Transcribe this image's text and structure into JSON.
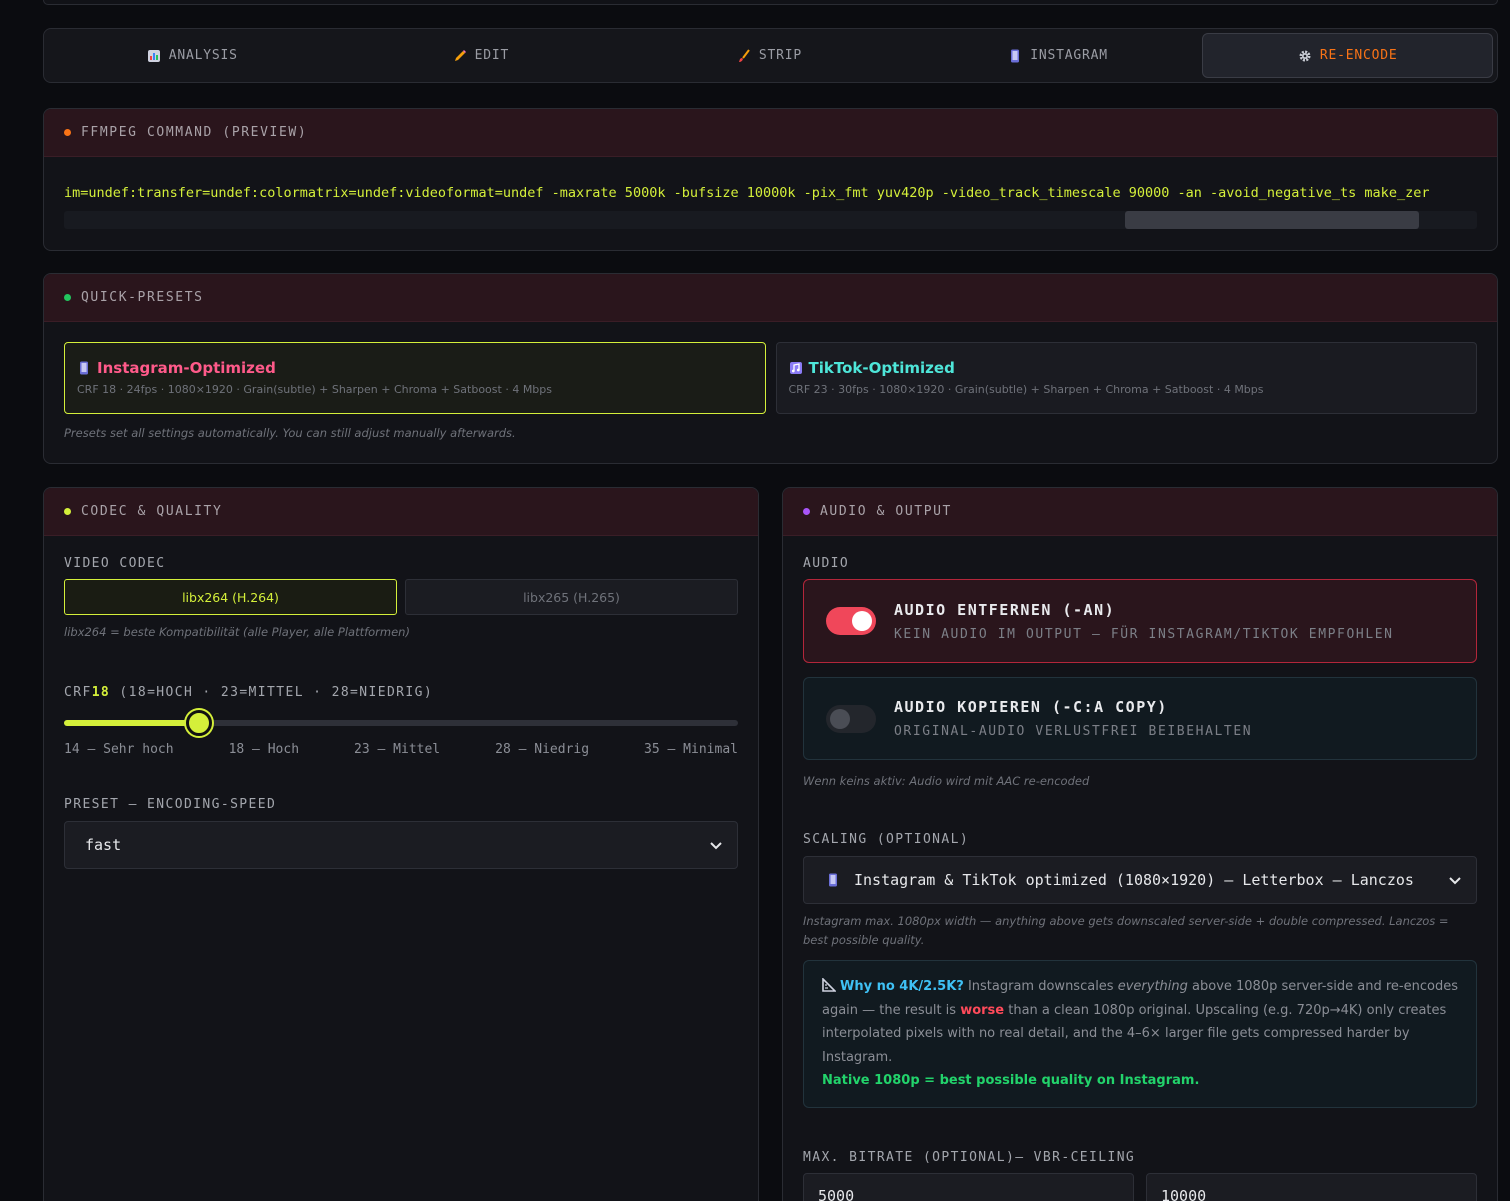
{
  "tabs": [
    {
      "label": "ANALYSIS",
      "icon": "chart-icon"
    },
    {
      "label": "EDIT",
      "icon": "pencil-icon"
    },
    {
      "label": "STRIP",
      "icon": "brush-icon"
    },
    {
      "label": "INSTAGRAM",
      "icon": "phone-icon"
    },
    {
      "label": "RE-ENCODE",
      "icon": "gear-icon",
      "active": true
    }
  ],
  "command": {
    "title": "FFMPEG COMMAND (PREVIEW)",
    "dot_color": "#f97316",
    "text": "im=undef:transfer=undef:colormatrix=undef:videoformat=undef -maxrate 5000k -bufsize 10000k -pix_fmt yuv420p -video_track_timescale 90000 -an -avoid_negative_ts make_zer"
  },
  "presets": {
    "title": "QUICK-PRESETS",
    "dot_color": "#22c55e",
    "items": [
      {
        "title": "Instagram-Optimized",
        "sub": "CRF 18 · 24fps · 1080×1920 · Grain(subtle) + Sharpen + Chroma + Satboost · 4 Mbps",
        "color": "#ff5a8a",
        "icon": "phone-icon"
      },
      {
        "title": "TikTok-Optimized",
        "sub": "CRF 23 · 30fps · 1080×1920 · Grain(subtle) + Sharpen + Chroma + Satboost · 4 Mbps",
        "color": "#4ee6d9",
        "icon": "music-icon"
      }
    ],
    "note": "Presets set all settings automatically. You can still adjust manually afterwards."
  },
  "codec": {
    "title": "CODEC & QUALITY",
    "dot_color": "#d4ef3a",
    "video_codec_label": "VIDEO CODEC",
    "options": [
      "libx264 (H.264)",
      "libx265 (H.265)"
    ],
    "selected": "libx264 (H.264)",
    "note": "libx264 = beste Kompatibilität (alle Player, alle Plattformen)",
    "crf_prefix": "CRF",
    "crf_value": "18",
    "crf_hint": " (18=HOCH · 23=MITTEL · 28=NIEDRIG)",
    "crf_fraction": 0.2,
    "crf_ticks": [
      "14 — Sehr hoch",
      "18 — Hoch",
      "23 — Mittel",
      "28 — Niedrig",
      "35 — Minimal"
    ],
    "preset_label": "PRESET — ENCODING-SPEED",
    "preset_value": "fast"
  },
  "audio": {
    "title": "AUDIO & OUTPUT",
    "dot_color": "#a855f7",
    "audio_label": "AUDIO",
    "remove": {
      "title": "AUDIO ENTFERNEN (-AN)",
      "sub": "KEIN AUDIO IM OUTPUT — FÜR INSTAGRAM/TIKTOK EMPFOHLEN",
      "on": true
    },
    "copy": {
      "title": "AUDIO KOPIEREN (-C:A COPY)",
      "sub": "ORIGINAL-AUDIO VERLUSTFREI BEIBEHALTEN",
      "on": false
    },
    "audio_note": "Wenn keins aktiv: Audio wird mit AAC re-encoded",
    "scaling_label": "SCALING (OPTIONAL)",
    "scaling_value": "Instagram & TikTok optimized (1080×1920) — Letterbox — Lanczos",
    "scaling_note": "Instagram max. 1080px width — anything above gets downscaled server-side + double compressed. Lanczos = best possible quality.",
    "info": {
      "q": "Why no 4K/2.5K?",
      "t1": " Instagram downscales ",
      "em": "everything",
      "t2": " above 1080p server-side and re-encodes again — the result is ",
      "worse": "worse",
      "t3": " than a clean 1080p original. Upscaling (e.g. 720p→4K) only creates interpolated pixels with no real detail, and the 4–6× larger file gets compressed harder by Instagram.",
      "native": "Native 1080p = best possible quality on Instagram."
    },
    "bitrate_label": "MAX. BITRATE (OPTIONAL)— VBR-CEILING",
    "maxrate": "5000",
    "bufsize": "10000"
  }
}
